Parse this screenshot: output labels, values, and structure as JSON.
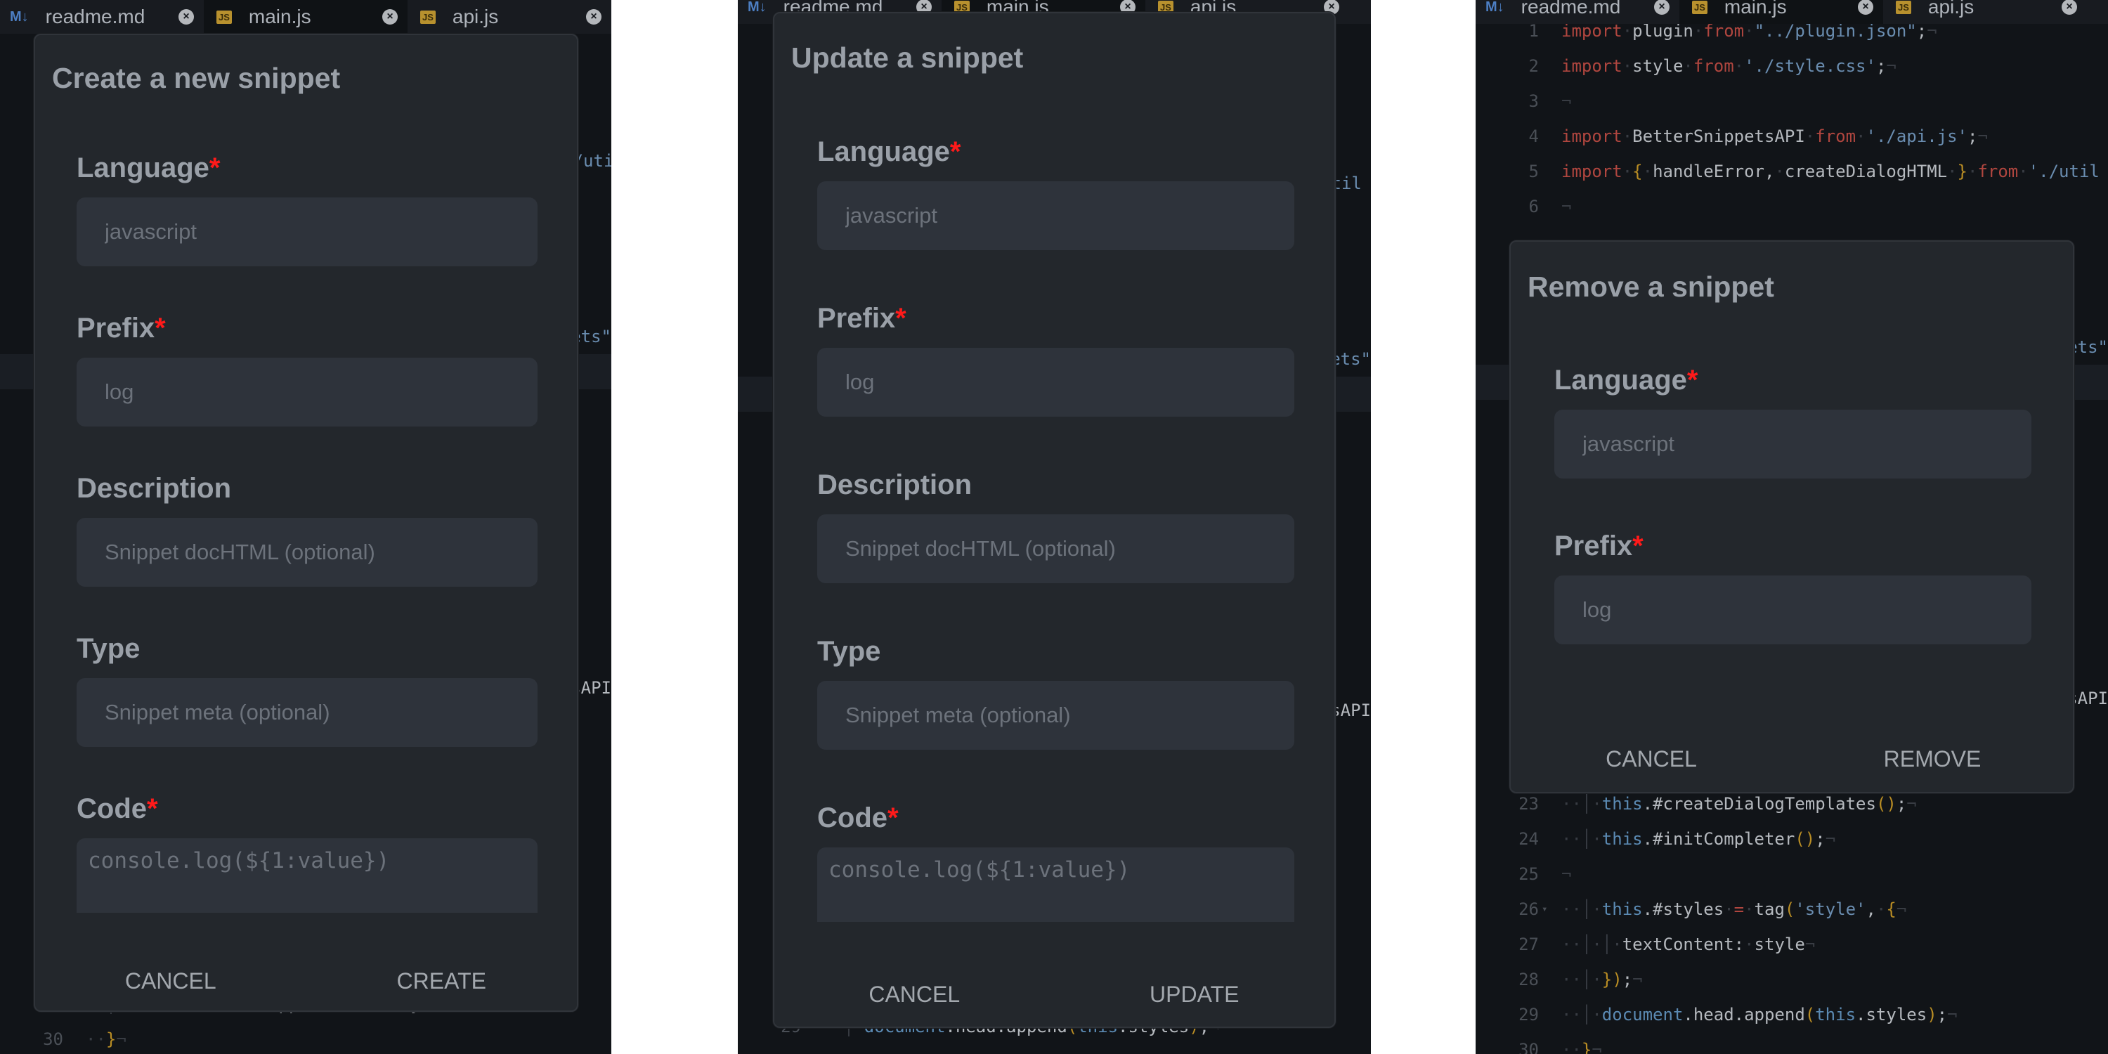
{
  "tabs": [
    {
      "label": "readme.md",
      "icon": "markdown-icon",
      "icon_text": "M↓",
      "active": false
    },
    {
      "label": "main.js",
      "icon": "js-file-icon",
      "icon_text": "JS",
      "active": true
    },
    {
      "label": "api.js",
      "icon": "js-file-icon",
      "icon_text": "JS",
      "active": false
    }
  ],
  "editor": {
    "active_line": 11,
    "lines": [
      {
        "n": 1,
        "tokens": [
          [
            "import",
            "k"
          ],
          [
            "·",
            "w"
          ],
          [
            "plugin",
            "t"
          ],
          [
            "·",
            "w"
          ],
          [
            "from",
            "k"
          ],
          [
            "·",
            "w"
          ],
          [
            "\"../plugin.json\"",
            "s"
          ],
          [
            ";",
            "t"
          ],
          [
            "¬",
            "w"
          ]
        ]
      },
      {
        "n": 2,
        "tokens": [
          [
            "import",
            "k"
          ],
          [
            "·",
            "w"
          ],
          [
            "style",
            "t"
          ],
          [
            "·",
            "w"
          ],
          [
            "from",
            "k"
          ],
          [
            "·",
            "w"
          ],
          [
            "'./style.css'",
            "s"
          ],
          [
            ";",
            "t"
          ],
          [
            "¬",
            "w"
          ]
        ]
      },
      {
        "n": 3,
        "tokens": [
          [
            "¬",
            "w"
          ]
        ]
      },
      {
        "n": 4,
        "tokens": [
          [
            "import",
            "k"
          ],
          [
            "·",
            "w"
          ],
          [
            "BetterSnippetsAPI",
            "t"
          ],
          [
            "·",
            "w"
          ],
          [
            "from",
            "k"
          ],
          [
            "·",
            "w"
          ],
          [
            "'./api.js'",
            "s"
          ],
          [
            ";",
            "t"
          ],
          [
            "¬",
            "w"
          ]
        ]
      },
      {
        "n": 5,
        "tokens": [
          [
            "import",
            "k"
          ],
          [
            "·",
            "w"
          ],
          [
            "{",
            "b"
          ],
          [
            "·",
            "w"
          ],
          [
            "handleError,",
            "t"
          ],
          [
            "·",
            "w"
          ],
          [
            "createDialogHTML",
            "t"
          ],
          [
            "·",
            "w"
          ],
          [
            "}",
            "b"
          ],
          [
            "·",
            "w"
          ],
          [
            "from",
            "k"
          ],
          [
            "·",
            "w"
          ],
          [
            "'./util",
            "s"
          ]
        ]
      },
      {
        "n": 6,
        "tokens": [
          [
            "¬",
            "w"
          ]
        ]
      },
      {
        "n": 23,
        "tokens": [
          [
            "··│·",
            "w"
          ],
          [
            "this",
            "v"
          ],
          [
            ".#createDialogTemplates",
            "t"
          ],
          [
            "()",
            "b"
          ],
          [
            ";",
            "t"
          ],
          [
            "¬",
            "w"
          ]
        ]
      },
      {
        "n": 24,
        "tokens": [
          [
            "··│·",
            "w"
          ],
          [
            "this",
            "v"
          ],
          [
            ".#initCompleter",
            "t"
          ],
          [
            "()",
            "b"
          ],
          [
            ";",
            "t"
          ],
          [
            "¬",
            "w"
          ]
        ]
      },
      {
        "n": 25,
        "tokens": [
          [
            "¬",
            "w"
          ]
        ]
      },
      {
        "n": 26,
        "fold": true,
        "tokens": [
          [
            "··│·",
            "w"
          ],
          [
            "this",
            "v"
          ],
          [
            ".#styles",
            "t"
          ],
          [
            "·",
            "w"
          ],
          [
            "=",
            "o"
          ],
          [
            "·",
            "w"
          ],
          [
            "tag",
            "t"
          ],
          [
            "(",
            "b"
          ],
          [
            "'style'",
            "s"
          ],
          [
            ",",
            "t"
          ],
          [
            "·",
            "w"
          ],
          [
            "{",
            "b"
          ],
          [
            "¬",
            "w"
          ]
        ]
      },
      {
        "n": 27,
        "tokens": [
          [
            "··│·│·",
            "w"
          ],
          [
            "textContent:",
            "t"
          ],
          [
            "·",
            "w"
          ],
          [
            "style",
            "t"
          ],
          [
            "¬",
            "w"
          ]
        ]
      },
      {
        "n": 28,
        "tokens": [
          [
            "··│·",
            "w"
          ],
          [
            "})",
            "b"
          ],
          [
            ";",
            "t"
          ],
          [
            "¬",
            "w"
          ]
        ]
      },
      {
        "n": 29,
        "tokens": [
          [
            "··│·",
            "w"
          ],
          [
            "document",
            "v"
          ],
          [
            ".head.append",
            "t"
          ],
          [
            "(",
            "b"
          ],
          [
            "this",
            "v"
          ],
          [
            ".styles",
            "t"
          ],
          [
            ")",
            "b"
          ],
          [
            ";",
            "t"
          ],
          [
            "¬",
            "w"
          ]
        ]
      },
      {
        "n": 30,
        "tokens": [
          [
            "··",
            "w"
          ],
          [
            "}",
            "b"
          ],
          [
            "¬",
            "w"
          ]
        ]
      }
    ],
    "fragments": [
      {
        "n": 10,
        "tokens": [
          [
            "ets\"",
            "s"
          ]
        ]
      },
      {
        "n": 20,
        "tokens": [
          [
            "sAPI",
            "t"
          ]
        ]
      }
    ]
  },
  "dialogs": [
    {
      "title": "Create a new snippet",
      "fields": [
        {
          "label": "Language",
          "required": true,
          "placeholder": "javascript"
        },
        {
          "label": "Prefix",
          "required": true,
          "placeholder": "log"
        },
        {
          "label": "Description",
          "required": false,
          "placeholder": "Snippet docHTML (optional)"
        },
        {
          "label": "Type",
          "required": false,
          "placeholder": "Snippet meta (optional)"
        },
        {
          "label": "Code",
          "required": true,
          "placeholder": "console.log(${1:value})",
          "multiline": true
        }
      ],
      "buttons": [
        "CANCEL",
        "CREATE"
      ]
    },
    {
      "title": "Update a snippet",
      "fields": [
        {
          "label": "Language",
          "required": true,
          "placeholder": "javascript"
        },
        {
          "label": "Prefix",
          "required": true,
          "placeholder": "log"
        },
        {
          "label": "Description",
          "required": false,
          "placeholder": "Snippet docHTML (optional)"
        },
        {
          "label": "Type",
          "required": false,
          "placeholder": "Snippet meta (optional)"
        },
        {
          "label": "Code",
          "required": true,
          "placeholder": "console.log(${1:value})",
          "multiline": true
        }
      ],
      "buttons": [
        "CANCEL",
        "UPDATE"
      ]
    },
    {
      "title": "Remove a snippet",
      "fields": [
        {
          "label": "Language",
          "required": true,
          "placeholder": "javascript"
        },
        {
          "label": "Prefix",
          "required": true,
          "placeholder": "log"
        }
      ],
      "buttons": [
        "CANCEL",
        "REMOVE"
      ]
    }
  ],
  "required_marker": "*",
  "colors": {
    "required": "#ff1a1a",
    "dialog_bg": "#23272c",
    "input_bg": "#2e333b",
    "editor_bg": "#111418"
  }
}
